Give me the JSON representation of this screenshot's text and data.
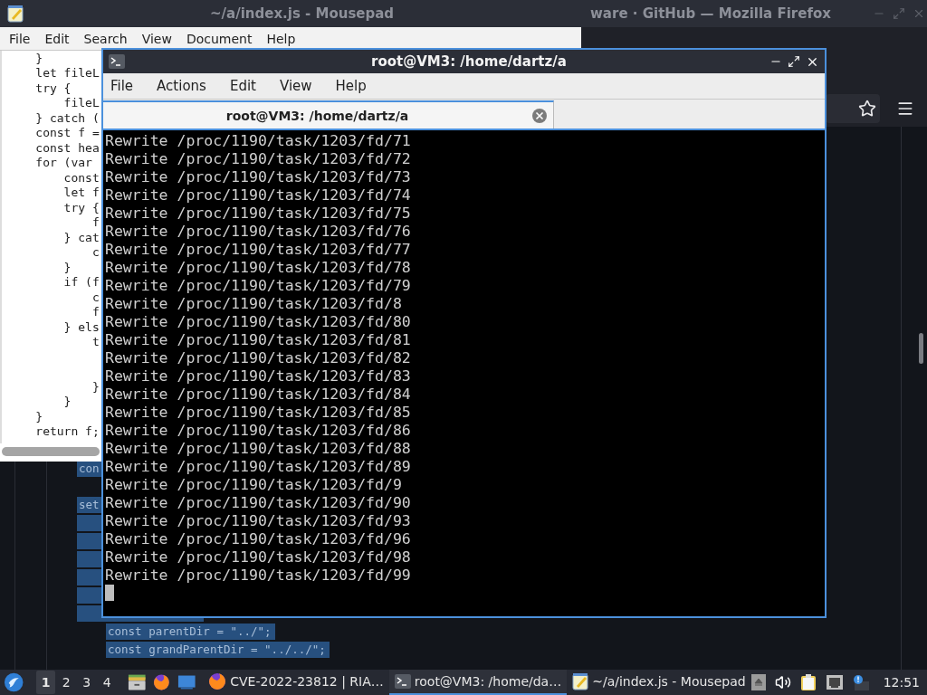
{
  "firefox": {
    "title": "ware · GitHub — Mozilla Firefox",
    "page_code": [
      {
        "text": "con",
        "selected": true
      },
      {
        "selected": false
      },
      {
        "text": "set",
        "selected": true
      },
      {
        "selected": true
      },
      {
        "selected": true
      },
      {
        "selected": true
      },
      {
        "selected": true
      },
      {
        "selected": true
      },
      {
        "selected": true
      },
      {
        "text": "const parentDir = \"../\";",
        "selected": true
      },
      {
        "text": "const grandParentDir = \"../../\";",
        "selected": true
      }
    ]
  },
  "mousepad": {
    "title": "~/a/index.js - Mousepad",
    "menu": [
      "File",
      "Edit",
      "Search",
      "View",
      "Document",
      "Help"
    ],
    "code": [
      {
        "kind": "line",
        "text": "    }"
      },
      {
        "kind": "line",
        "text": "    let fileL"
      },
      {
        "kind": "line",
        "text": "    try {"
      },
      {
        "kind": "line",
        "text": "        fileL"
      },
      {
        "kind": "line",
        "text": "    } catch ("
      },
      {
        "kind": "line",
        "text": "    const f ="
      },
      {
        "kind": "line",
        "text": "    const hea"
      },
      {
        "kind": "line",
        "text": "    for (var"
      },
      {
        "kind": "line",
        "text": "        const"
      },
      {
        "kind": "line",
        "text": "        let f"
      },
      {
        "kind": "line",
        "text": "        try {"
      },
      {
        "kind": "line",
        "text": "            f"
      },
      {
        "kind": "line",
        "text": "        } cat"
      },
      {
        "kind": "line",
        "text": "            c"
      },
      {
        "kind": "line",
        "text": "        }"
      },
      {
        "kind": "line",
        "text": "        if (f"
      },
      {
        "kind": "line",
        "text": "            c"
      },
      {
        "kind": "line",
        "text": "            f"
      },
      {
        "kind": "line",
        "text": "        } els"
      },
      {
        "kind": "line",
        "text": "            t"
      },
      {
        "kind": "blank"
      },
      {
        "kind": "blank"
      },
      {
        "kind": "line",
        "text": "            }"
      },
      {
        "kind": "line",
        "text": "        }"
      },
      {
        "kind": "line",
        "text": "    }"
      },
      {
        "kind": "line",
        "text": "    return f;"
      }
    ]
  },
  "terminal": {
    "title": "root@VM3: /home/dartz/a",
    "menu": [
      "File",
      "Actions",
      "Edit",
      "View",
      "Help"
    ],
    "tabs": [
      {
        "label": "root@VM3: /home/dartz/a",
        "selected": true
      }
    ],
    "lines": [
      "Rewrite /proc/1190/task/1203/fd/71",
      "Rewrite /proc/1190/task/1203/fd/72",
      "Rewrite /proc/1190/task/1203/fd/73",
      "Rewrite /proc/1190/task/1203/fd/74",
      "Rewrite /proc/1190/task/1203/fd/75",
      "Rewrite /proc/1190/task/1203/fd/76",
      "Rewrite /proc/1190/task/1203/fd/77",
      "Rewrite /proc/1190/task/1203/fd/78",
      "Rewrite /proc/1190/task/1203/fd/79",
      "Rewrite /proc/1190/task/1203/fd/8",
      "Rewrite /proc/1190/task/1203/fd/80",
      "Rewrite /proc/1190/task/1203/fd/81",
      "Rewrite /proc/1190/task/1203/fd/82",
      "Rewrite /proc/1190/task/1203/fd/83",
      "Rewrite /proc/1190/task/1203/fd/84",
      "Rewrite /proc/1190/task/1203/fd/85",
      "Rewrite /proc/1190/task/1203/fd/86",
      "Rewrite /proc/1190/task/1203/fd/88",
      "Rewrite /proc/1190/task/1203/fd/89",
      "Rewrite /proc/1190/task/1203/fd/9",
      "Rewrite /proc/1190/task/1203/fd/90",
      "Rewrite /proc/1190/task/1203/fd/93",
      "Rewrite /proc/1190/task/1203/fd/96",
      "Rewrite /proc/1190/task/1203/fd/98",
      "Rewrite /proc/1190/task/1203/fd/99"
    ]
  },
  "taskbar": {
    "workspaces": [
      {
        "label": "1",
        "selected": true
      },
      {
        "label": "2",
        "selected": false
      },
      {
        "label": "3",
        "selected": false
      },
      {
        "label": "4",
        "selected": false
      }
    ],
    "tasks": [
      {
        "kind": "firefox",
        "label": "CVE-2022-23812 | RIA…",
        "selected": false
      },
      {
        "kind": "terminal",
        "label": "root@VM3: /home/da…",
        "selected": true
      },
      {
        "kind": "mousepad",
        "label": "~/a/index.js - Mousepad",
        "selected": false
      }
    ],
    "clock": "12:51"
  }
}
